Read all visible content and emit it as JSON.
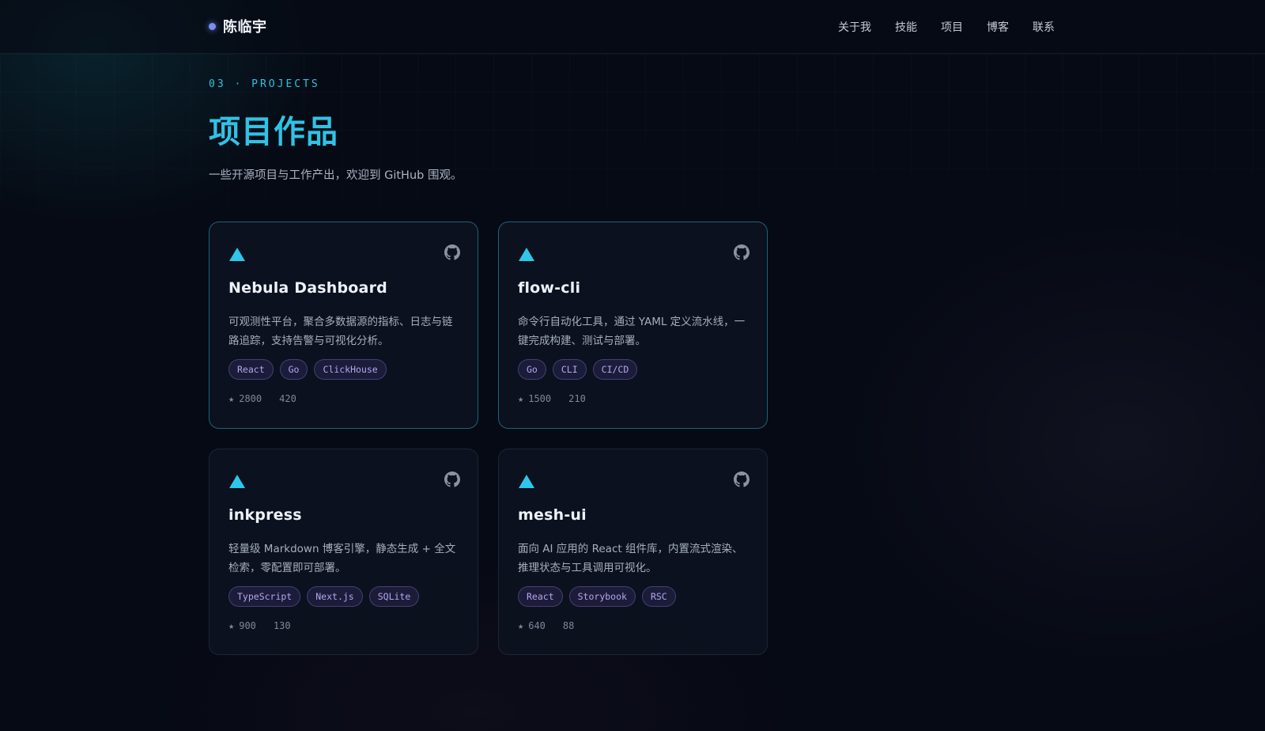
{
  "header": {
    "brand": "陈临宇",
    "nav": [
      "关于我",
      "技能",
      "项目",
      "博客",
      "联系"
    ]
  },
  "section": {
    "eyebrow": "03 · PROJECTS",
    "title": "项目作品",
    "subtitle": "一些开源项目与工作产出，欢迎到 GitHub 围观。"
  },
  "projects": [
    {
      "name": "Nebula Dashboard",
      "desc": "可观测性平台，聚合多数据源的指标、日志与链路追踪，支持告警与可视化分析。",
      "tags": [
        "React",
        "Go",
        "ClickHouse"
      ],
      "star_icon": "★",
      "stars": "2800",
      "fork_icon": "",
      "forks": "420"
    },
    {
      "name": "flow-cli",
      "desc": "命令行自动化工具，通过 YAML 定义流水线，一键完成构建、测试与部署。",
      "tags": [
        "Go",
        "CLI",
        "CI/CD"
      ],
      "star_icon": "★",
      "stars": "1500",
      "fork_icon": "",
      "forks": "210"
    },
    {
      "name": "inkpress",
      "desc": "轻量级 Markdown 博客引擎，静态生成 + 全文检索，零配置即可部署。",
      "tags": [
        "TypeScript",
        "Next.js",
        "SQLite"
      ],
      "star_icon": "★",
      "stars": "900",
      "fork_icon": "",
      "forks": "130"
    },
    {
      "name": "mesh-ui",
      "desc": "面向 AI 应用的 React 组件库，内置流式渲染、推理状态与工具调用可视化。",
      "tags": [
        "React",
        "Storybook",
        "RSC"
      ],
      "star_icon": "★",
      "stars": "640",
      "fork_icon": "",
      "forks": "88"
    }
  ],
  "icons": {
    "project": "triangle-icon",
    "repo": "github-icon"
  },
  "colors": {
    "accent": "#30c2e6",
    "tag_text": "#b5a6f2",
    "background": "#060a14"
  }
}
